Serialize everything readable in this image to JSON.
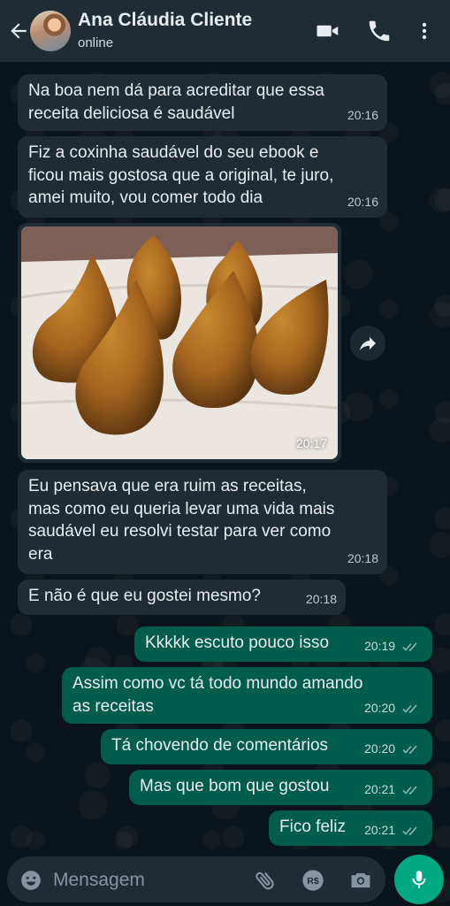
{
  "header": {
    "contact_name": "Ana Cláudia Cliente",
    "status": "online",
    "icons": [
      "back-arrow-icon",
      "video-call-icon",
      "voice-call-icon",
      "more-options-icon"
    ]
  },
  "messages": [
    {
      "direction": "in",
      "text": "Na boa nem dá para acreditar que essa\nreceita deliciosa é saudável",
      "time": "20:16"
    },
    {
      "direction": "in",
      "text": "Fiz a coxinha saudável do seu ebook e\nficou mais gostosa que a original, te juro,\namei muito, vou comer todo dia",
      "time": "20:16"
    },
    {
      "direction": "in",
      "type": "image",
      "description": "coxinhas",
      "time": "20:17"
    },
    {
      "direction": "in",
      "text": "Eu pensava que era ruim as receitas,\nmas como eu queria levar uma vida mais\nsaudável eu resolvi testar para ver como\nera",
      "time": "20:18"
    },
    {
      "direction": "in",
      "text": "E não é que eu gostei mesmo?",
      "time": "20:18"
    },
    {
      "direction": "out",
      "text": "Kkkkk escuto pouco isso",
      "time": "20:19",
      "status": "read"
    },
    {
      "direction": "out",
      "text": "Assim como vc tá todo mundo amando\nas receitas",
      "time": "20:20",
      "status": "read"
    },
    {
      "direction": "out",
      "text": "Tá chovendo de comentários",
      "time": "20:20",
      "status": "read"
    },
    {
      "direction": "out",
      "text": "Mas que bom que gostou",
      "time": "20:21",
      "status": "read"
    },
    {
      "direction": "out",
      "text": "Fico feliz",
      "time": "20:21",
      "status": "read"
    }
  ],
  "composer": {
    "placeholder": "Mensagem"
  },
  "colors": {
    "background": "#0b141a",
    "header": "#1f2c33",
    "incoming_bubble": "#202c33",
    "outgoing_bubble": "#005c4b",
    "accent": "#00a884",
    "read_ticks": "#53bdeb"
  }
}
